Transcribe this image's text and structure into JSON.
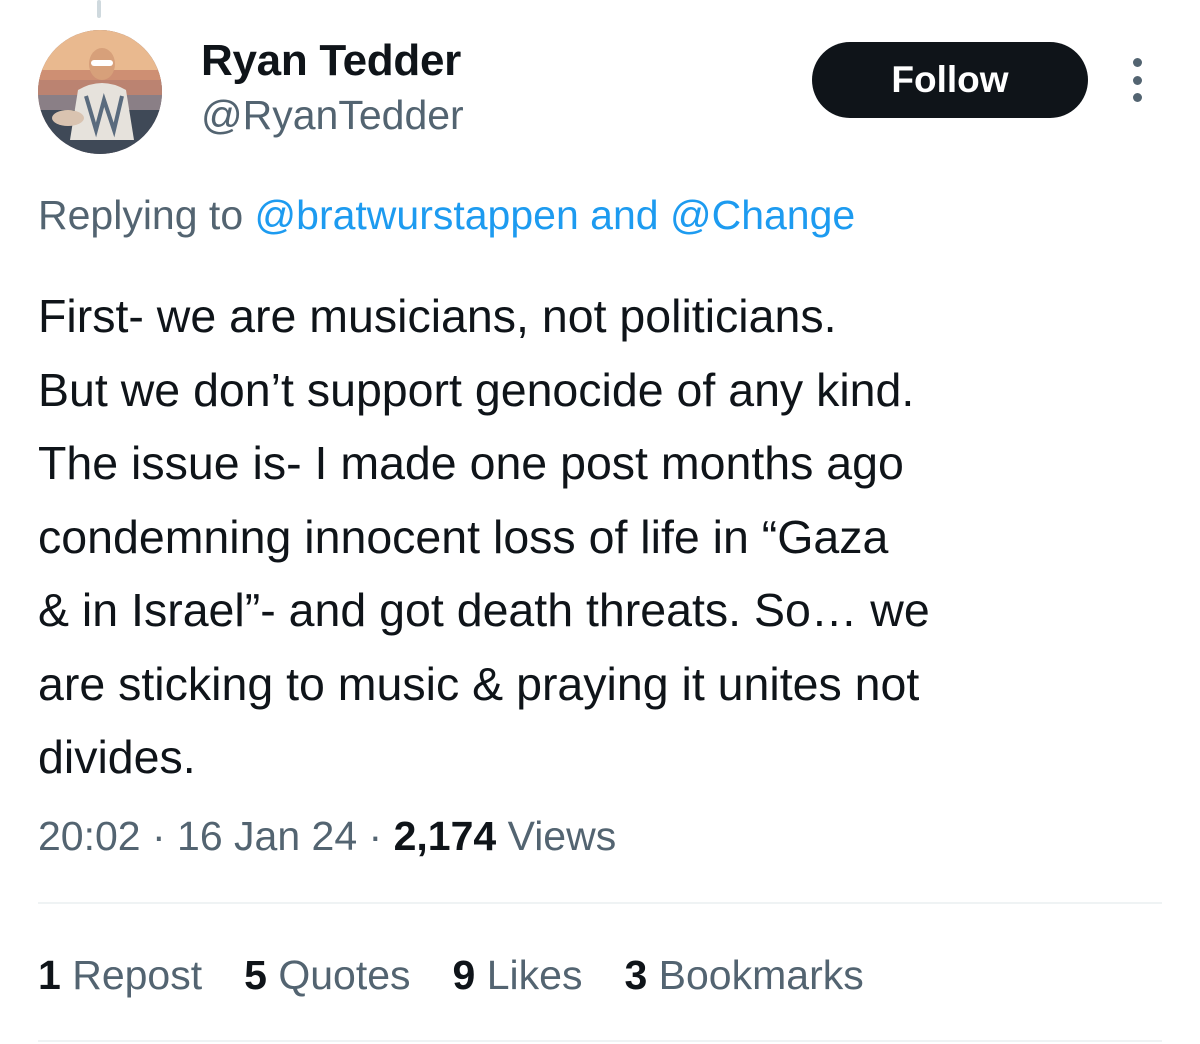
{
  "author": {
    "name": "Ryan Tedder",
    "handle": "@RyanTedder"
  },
  "follow_button": {
    "label": "Follow"
  },
  "more_icon": "more-options-icon",
  "reply_context": {
    "prefix": "Replying to ",
    "mention_1": "@bratwurstappen",
    "joiner": " and ",
    "mention_2": "@Change"
  },
  "tweet": {
    "lines": [
      "First- we are musicians,  not politicians.",
      "But we don’t support genocide of any kind.",
      "The issue is- I made one post months ago",
      "condemning innocent loss of life in “Gaza",
      "& in Israel”- and got death threats.  So… we",
      "are sticking to music & praying it unites not",
      "divides."
    ]
  },
  "meta": {
    "time": "20:02",
    "separator": " · ",
    "date": "16 Jan 24",
    "views_count": "2,174",
    "views_label": " Views"
  },
  "stats": {
    "reposts_count": "1",
    "reposts_label": " Repost",
    "quotes_count": "5",
    "quotes_label": " Quotes",
    "likes_count": "9",
    "likes_label": " Likes",
    "bookmarks_count": "3",
    "bookmarks_label": " Bookmarks"
  }
}
